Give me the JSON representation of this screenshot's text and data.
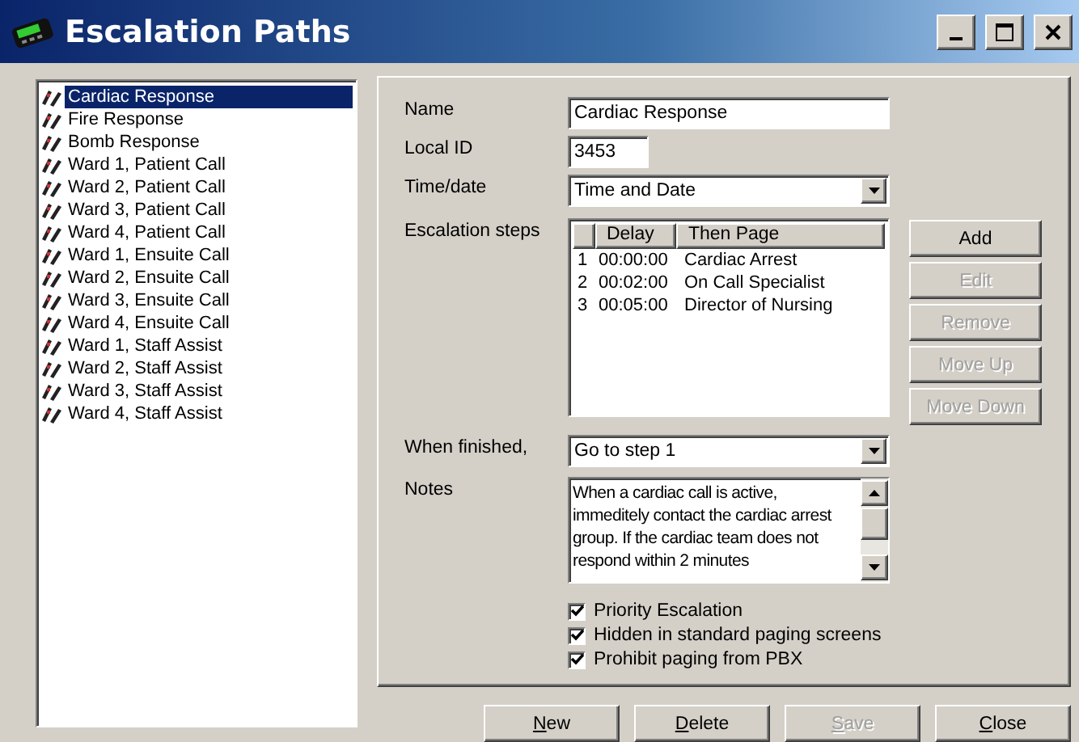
{
  "window": {
    "title": "Escalation Paths"
  },
  "paths": [
    {
      "label": "Cardiac Response",
      "selected": true
    },
    {
      "label": "Fire Response",
      "selected": false
    },
    {
      "label": "Bomb Response",
      "selected": false
    },
    {
      "label": "Ward 1, Patient Call",
      "selected": false
    },
    {
      "label": "Ward 2, Patient Call",
      "selected": false
    },
    {
      "label": "Ward 3, Patient Call",
      "selected": false
    },
    {
      "label": "Ward 4, Patient Call",
      "selected": false
    },
    {
      "label": "Ward 1, Ensuite Call",
      "selected": false
    },
    {
      "label": "Ward 2, Ensuite Call",
      "selected": false
    },
    {
      "label": "Ward 3, Ensuite Call",
      "selected": false
    },
    {
      "label": "Ward 4, Ensuite Call",
      "selected": false
    },
    {
      "label": "Ward 1, Staff Assist",
      "selected": false
    },
    {
      "label": "Ward 2, Staff Assist",
      "selected": false
    },
    {
      "label": "Ward 3, Staff Assist",
      "selected": false
    },
    {
      "label": "Ward 4, Staff Assist",
      "selected": false
    }
  ],
  "form": {
    "name_label": "Name",
    "name": "Cardiac Response",
    "local_id_label": "Local ID",
    "local_id": "3453",
    "time_date_label": "Time/date",
    "time_date": "Time and Date",
    "steps_label": "Escalation steps",
    "steps_columns": [
      "Delay",
      "Then Page"
    ],
    "steps": [
      {
        "num": "1",
        "delay": "00:00:00",
        "page": "Cardiac Arrest"
      },
      {
        "num": "2",
        "delay": "00:02:00",
        "page": "On Call Specialist"
      },
      {
        "num": "3",
        "delay": "00:05:00",
        "page": "Director of Nursing"
      }
    ],
    "step_buttons": [
      {
        "label": "Add",
        "disabled": false
      },
      {
        "label": "Edit",
        "disabled": true
      },
      {
        "label": "Remove",
        "disabled": true
      },
      {
        "label": "Move Up",
        "disabled": true
      },
      {
        "label": "Move Down",
        "disabled": true
      }
    ],
    "when_finished_label": "When finished,",
    "when_finished": "Go to step 1",
    "notes_label": "Notes",
    "notes": "When a cardiac call is active, immeditely contact the cardiac arrest group.  If the cardiac team does not respond within 2 minutes",
    "options": [
      {
        "label": "Priority Escalation",
        "checked": true
      },
      {
        "label": "Hidden in standard paging screens",
        "checked": true
      },
      {
        "label": "Prohibit paging from PBX",
        "checked": true
      }
    ]
  },
  "buttons": [
    {
      "label": "New",
      "disabled": false
    },
    {
      "label": "Delete",
      "disabled": false
    },
    {
      "label": "Save",
      "disabled": true
    },
    {
      "label": "Close",
      "disabled": false
    }
  ]
}
